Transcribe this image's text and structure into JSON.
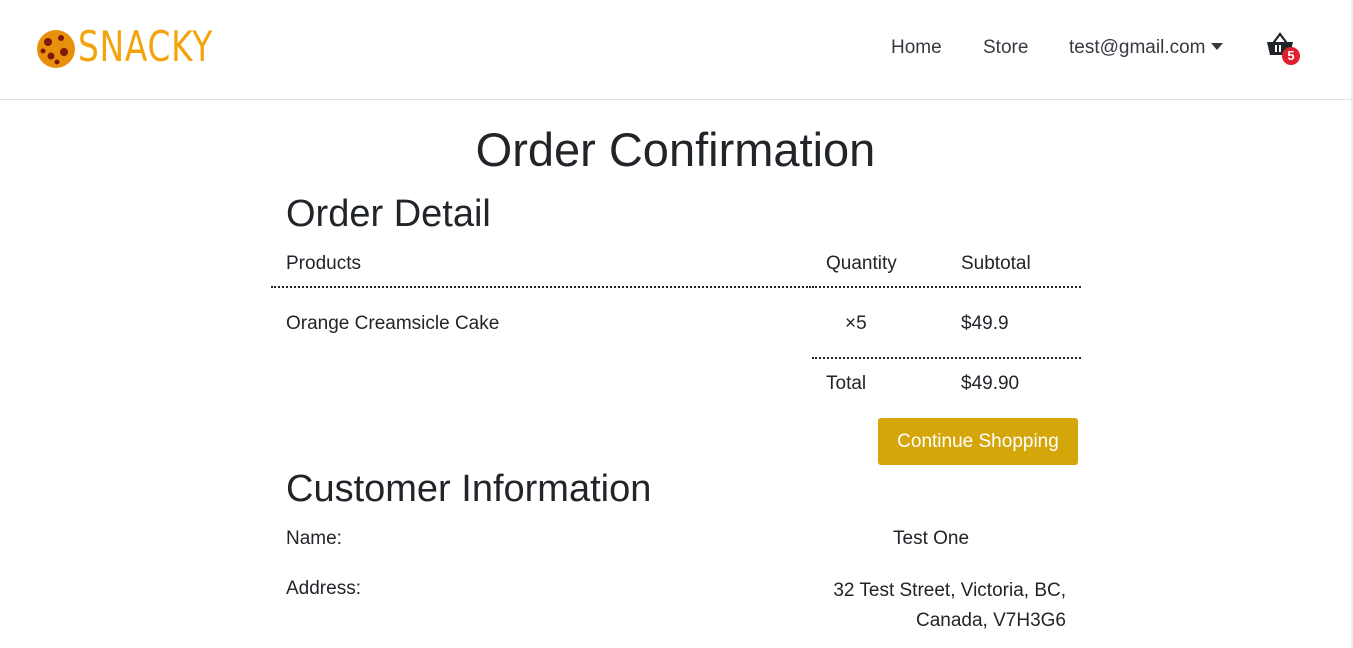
{
  "brand": {
    "name": "SNACKY",
    "logo_icon": "cookie-icon",
    "color": "#f5a30d"
  },
  "nav": {
    "links": [
      "Home",
      "Store"
    ],
    "user": "test@gmail.com",
    "cart_icon": "basket-icon",
    "cart_count": "5"
  },
  "page": {
    "title": "Order Confirmation"
  },
  "order": {
    "heading": "Order Detail",
    "columns": [
      "Products",
      "Quantity",
      "Subtotal"
    ],
    "rows": [
      {
        "product": "Orange Creamsicle Cake",
        "quantity": "×5",
        "subtotal": "$49.9"
      }
    ],
    "total_label": "Total",
    "total_value": "$49.90",
    "continue_label": "Continue Shopping"
  },
  "customer": {
    "heading": "Customer Information",
    "name_label": "Name:",
    "name_value": "Test One",
    "address_label": "Address:",
    "address_line1": "32 Test Street, Victoria, BC,",
    "address_line2": "Canada, V7H3G6"
  },
  "colors": {
    "accent_button": "#d4a60a",
    "badge": "#e0202e",
    "text": "#212529"
  }
}
